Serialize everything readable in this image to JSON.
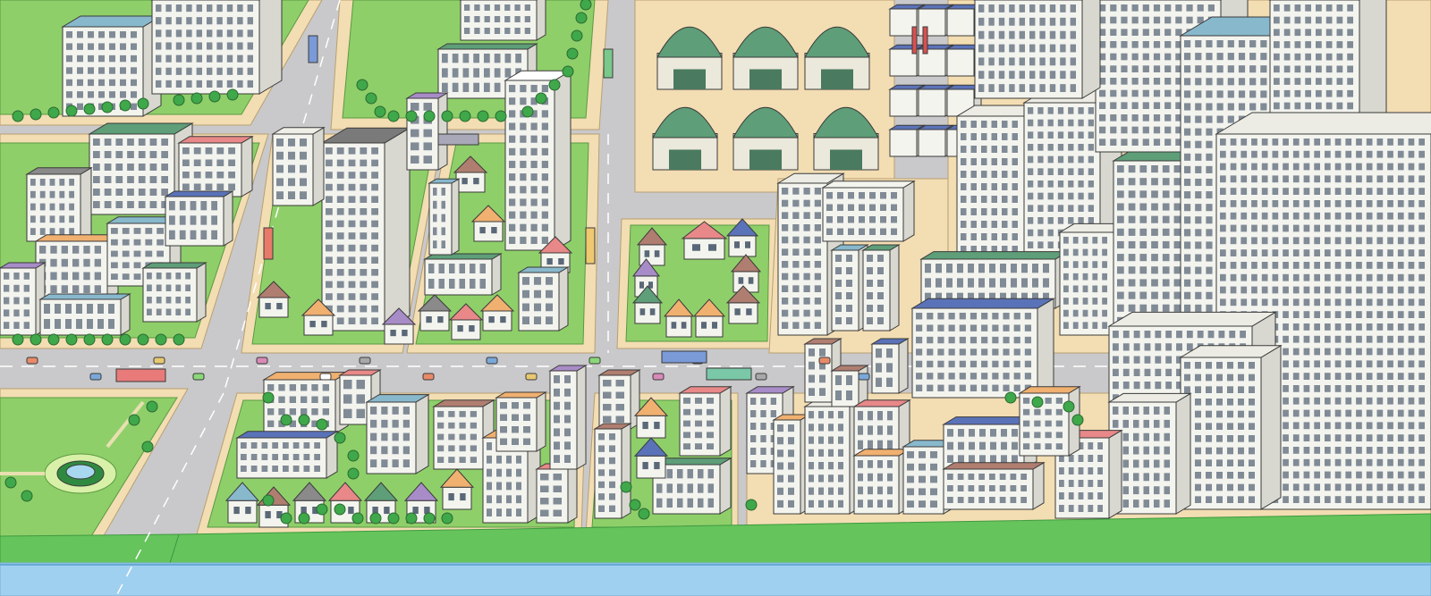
{
  "scene": {
    "description_visible_text": "",
    "palette": {
      "road": "#c9c9cb",
      "sidewalk": "#f3ddb3",
      "grass": "#8fcf6a",
      "grass_dark": "#5fb84a",
      "river_bank": "#65c45b",
      "water": "#9fd0f0",
      "building_white": "#f4f4ef",
      "building_shade": "#d8d8d0",
      "roof_green": "#5e9e78",
      "roof_blue": "#5a72b8",
      "roof_red": "#e88888",
      "roof_orange": "#f0b070",
      "roof_purple": "#a88cc8",
      "roof_teal": "#88b8cc",
      "roof_brown": "#b07e70",
      "tree": "#3fa84a",
      "outline": "#3a3a3a"
    }
  }
}
